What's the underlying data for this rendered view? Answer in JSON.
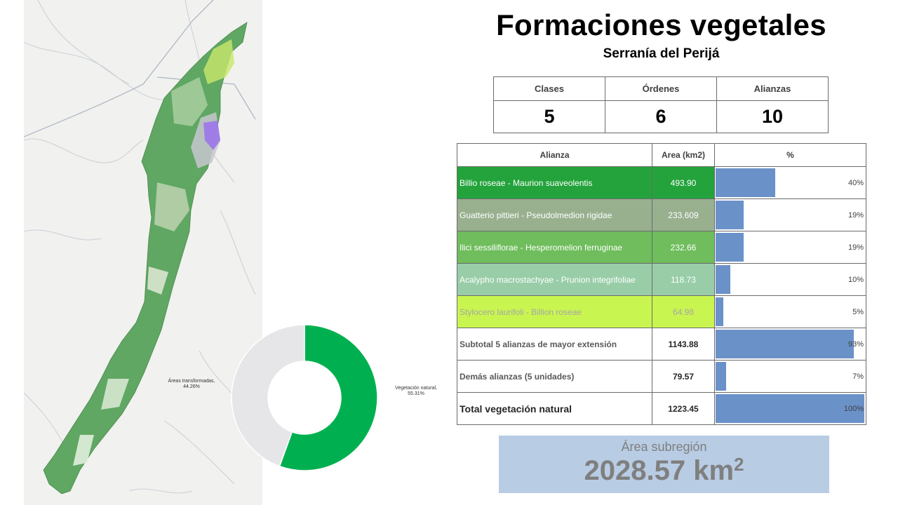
{
  "title": "Formaciones vegetales",
  "subtitle": "Serranía del Perijá",
  "summary": {
    "headers": [
      "Clases",
      "Órdenes",
      "Alianzas"
    ],
    "values": [
      "5",
      "6",
      "10"
    ]
  },
  "alliance_table": {
    "headers": [
      "Alianza",
      "Area (km2)",
      "%"
    ],
    "rows": [
      {
        "name": "Billio roseae - Maurion suaveolentis",
        "area": "493.90",
        "pct": "40%",
        "pct_value": 40,
        "color": "#24a33c"
      },
      {
        "name": "Guatterio pittieri - Pseudolmedion rigidae",
        "area": "233.609",
        "pct": "19%",
        "pct_value": 19,
        "color": "#99b08f"
      },
      {
        "name": "Ilici sessiliflorae - Hesperomelion ferruginae",
        "area": "232.66",
        "pct": "19%",
        "pct_value": 19,
        "color": "#6fbd5c"
      },
      {
        "name": "Acalypho macrostachyae - Prunion integrifoliae",
        "area": "118.73",
        "pct": "10%",
        "pct_value": 10,
        "color": "#98cda8"
      },
      {
        "name": "Stylocero laurifoli - Billion roseae",
        "area": "64.98",
        "pct": "5%",
        "pct_value": 5,
        "color": "#c9f550"
      },
      {
        "name": "Subtotal 5 alianzas de mayor extensión",
        "area": "1143.88",
        "pct": "93%",
        "pct_value": 93,
        "color": "#ffffff"
      },
      {
        "name": "Demás alianzas (5 unidades)",
        "area": "79.57",
        "pct": "7%",
        "pct_value": 7,
        "color": "#ffffff"
      },
      {
        "name": "Total vegetación natural",
        "area": "1223.45",
        "pct": "100%",
        "pct_value": 100,
        "color": "#ffffff"
      }
    ]
  },
  "region": {
    "label": "Área subregión",
    "value": "2028.57 km",
    "unit_sup": "2"
  },
  "chart_data": {
    "type": "pie",
    "series": [
      {
        "name": "Vegetación natural,\n55.31%",
        "value": 55.31,
        "color": "#00b050"
      },
      {
        "name": "Áreas transformadas,\n44.26%",
        "value": 44.26,
        "color": "#e6e5e7"
      }
    ]
  }
}
